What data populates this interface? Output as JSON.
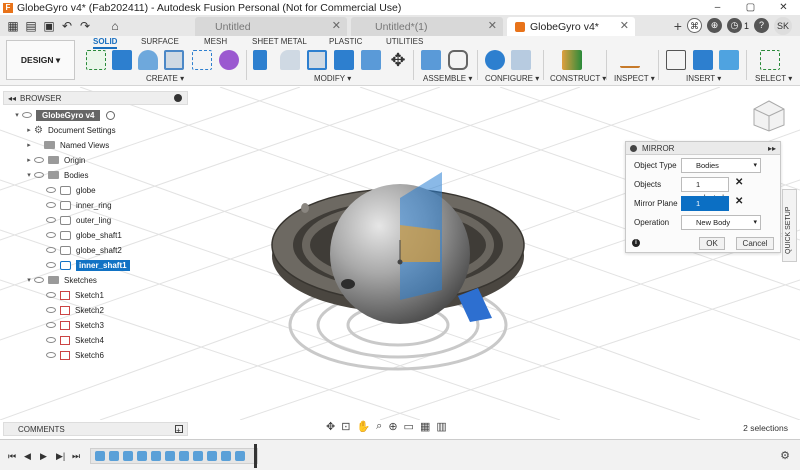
{
  "window": {
    "title": "GlobeGyro v4* (Fab202411) - Autodesk Fusion Personal (Not for Commercial Use)"
  },
  "tabs": [
    {
      "label": "Untitled"
    },
    {
      "label": "Untitled*(1)"
    },
    {
      "label": "GlobeGyro v4*"
    }
  ],
  "user": {
    "avatar": "SK",
    "notification_count": "1"
  },
  "toolbar": {
    "workspace": "DESIGN ▾",
    "workspace_tabs": [
      "SOLID",
      "SURFACE",
      "MESH",
      "SHEET METAL",
      "PLASTIC",
      "UTILITIES"
    ],
    "groups": [
      "CREATE ▾",
      "MODIFY ▾",
      "ASSEMBLE ▾",
      "CONFIGURE ▾",
      "CONSTRUCT ▾",
      "INSPECT ▾",
      "INSERT ▾",
      "SELECT ▾"
    ]
  },
  "browser": {
    "title": "BROWSER",
    "root": "GlobeGyro v4",
    "items": [
      "Document Settings",
      "Named Views",
      "Origin",
      "Bodies",
      "globe",
      "inner_ring",
      "outer_ling",
      "globe_shaft1",
      "globe_shaft2",
      "inner_shaft1",
      "Sketches",
      "Sketch1",
      "Sketch2",
      "Sketch3",
      "Sketch4",
      "Sketch6"
    ]
  },
  "mirror": {
    "title": "MIRROR",
    "object_type_label": "Object Type",
    "object_type_value": "Bodies",
    "objects_label": "Objects",
    "objects_value": "1 selected",
    "plane_label": "Mirror Plane",
    "plane_value": "1 selected",
    "operation_label": "Operation",
    "operation_value": "New Body",
    "ok": "OK",
    "cancel": "Cancel"
  },
  "quick_setup": "QUICK SETUP",
  "comments": {
    "label": "COMMENTS"
  },
  "status": {
    "selections": "2 selections"
  },
  "colors": {
    "accent": "#1172c4",
    "selection": "#0b6fc4",
    "brand": "#e8731a"
  }
}
